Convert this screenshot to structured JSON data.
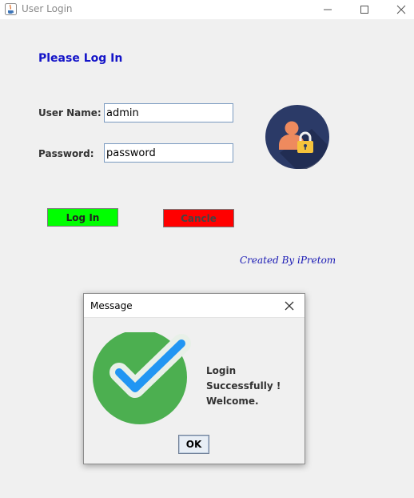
{
  "window": {
    "title": "User Login",
    "icon": "java-cup-icon"
  },
  "form": {
    "heading": "Please Log In",
    "username_label": "User Name:",
    "username_value": "admin",
    "password_label": "Password:",
    "password_value": "password",
    "login_label": "Log In",
    "cancel_label": "Cancle",
    "credit": "Created By iPretom",
    "avatar_icon": "user-lock-icon"
  },
  "colors": {
    "heading": "#1414c8",
    "login_button": "#00ff00",
    "cancel_button": "#ff0000",
    "credit": "#1a1ab4",
    "avatar_bg": "#2b3a67",
    "check_circle": "#4caf50",
    "check_mark": "#2196f3"
  },
  "dialog": {
    "title": "Message",
    "message_line1": "Login Successfully !",
    "message_line2": "Welcome.",
    "ok_label": "OK",
    "icon": "success-check-icon"
  }
}
